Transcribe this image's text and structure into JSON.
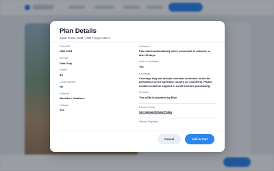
{
  "modal": {
    "title": "Plan Details",
    "subtitle": "Spain Travel eSIM | 1GB 7 Days USD 4",
    "left_fields": [
      {
        "label": "Price/GB",
        "value": "USD 4/GB"
      },
      {
        "label": "Service",
        "value": "Data Only"
      },
      {
        "label": "Speed",
        "value": "5G"
      },
      {
        "label": "Local Number",
        "value": "No"
      },
      {
        "label": "Network",
        "value": "Movistar / Vodafone"
      },
      {
        "label": "Hotspot",
        "value": "Yes"
      }
    ],
    "right_fields": [
      {
        "label": "Activation",
        "value": "Plan starts automatically when connected to network, or after 60 days"
      },
      {
        "label": "Add-on Available",
        "value": "Yes"
      },
      {
        "label": "Coverage",
        "value": "Coverage may not include overseas territories under the jurisdiction of the specified country (or countries). Please contact customer support to confirm before purchasing."
      },
      {
        "label": "Provider",
        "value": "This eSIM is provided by Blue"
      },
      {
        "label": "Refund Policy",
        "value": "See Nomad Refund Policy"
      },
      {
        "label": "Device Eligibility",
        "value": ""
      }
    ],
    "buttons": {
      "cancel": "Cancel",
      "add_to_cart": "Add to Cart"
    }
  },
  "colors": {
    "accent": "#2b86f0",
    "overlay": "rgba(15,23,35,0.42)"
  }
}
